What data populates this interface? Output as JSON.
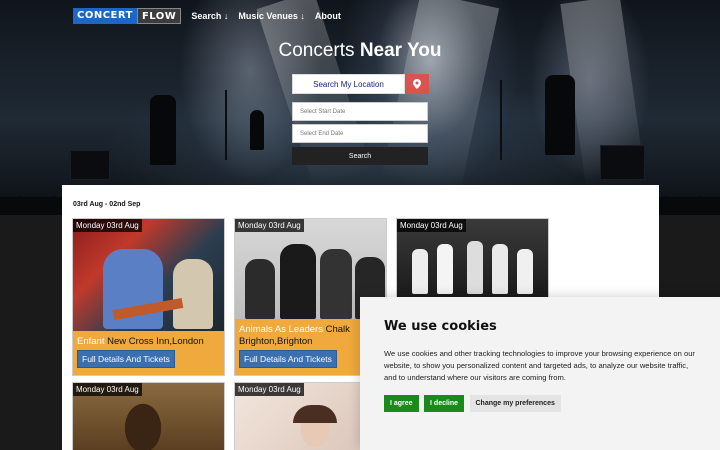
{
  "nav": {
    "logo_left": "CONCERT",
    "logo_right": "FLOW",
    "links": [
      "Search ↓",
      "Music Venues ↓",
      "About"
    ]
  },
  "hero": {
    "headline_light": "Concerts",
    "headline_bold": "Near You",
    "location_button": "Search My Location",
    "start_date_placeholder": "Select Start Date",
    "end_date_placeholder": "Select End Date",
    "search_button": "Search"
  },
  "listing": {
    "date_range": "03rd Aug - 02nd Sep",
    "cards": [
      {
        "day": "Monday 03rd Aug",
        "artist": "Enfant",
        "venue": "New Cross Inn,London",
        "details": "Full Details And Tickets"
      },
      {
        "day": "Monday 03rd Aug",
        "artist": "Animals As Leaders",
        "venue": "Chalk Brighton,Brighton",
        "details": "Full Details And Tickets"
      },
      {
        "day": "Monday 03rd Aug"
      },
      {
        "day": "Monday 03rd Aug"
      },
      {
        "day": "Monday 03rd Aug"
      }
    ]
  },
  "cookie": {
    "title": "We use cookies",
    "body": "We use cookies and other tracking technologies to improve your browsing experience on our website, to show you personalized content and targeted ads, to analyze our website traffic, and to understand where our visitors are coming from.",
    "agree": "I agree",
    "decline": "I decline",
    "preferences": "Change my preferences"
  },
  "colors": {
    "accent_blue": "#1a67c8",
    "card_orange": "#f0a93c",
    "pin_red": "#d9534f",
    "cookie_green": "#1a8a1a"
  },
  "icons": {
    "pin": "map-pin-icon"
  }
}
